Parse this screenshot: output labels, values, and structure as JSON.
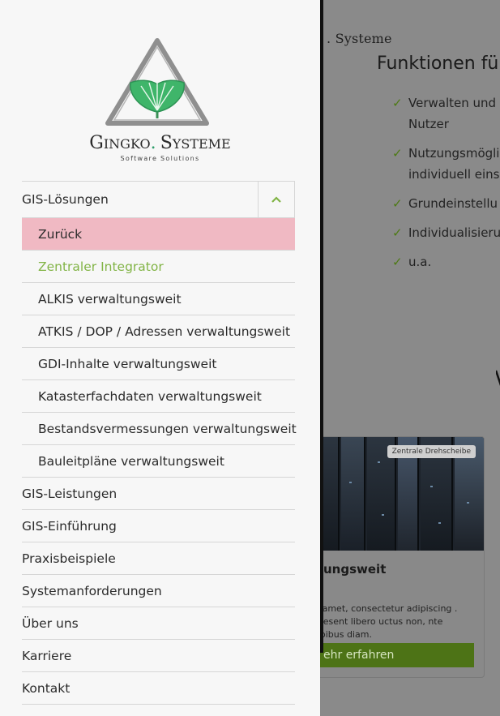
{
  "background_page": {
    "logo_text": ". Systeme",
    "heading": "Funktionen fü",
    "features": [
      {
        "text": "Verwalten und"
      },
      {
        "text": "Nutzer"
      },
      {
        "text": "Nutzungsmögli"
      },
      {
        "text": "individuell eins"
      },
      {
        "text": "Grundeinstellu"
      },
      {
        "text": "Individualisieru"
      },
      {
        "text": "u.a."
      }
    ],
    "check_symbol": "✓",
    "card": {
      "tag": "Zentrale Drehscheibe",
      "title": "ungsweit",
      "description": "sit amet, consectetur adipiscing . Praesent libero uctus non, nte dapibus diam.",
      "button_label": "ehr erfahren"
    }
  },
  "logo": {
    "wordmark_left_G": "G",
    "wordmark_left_rest": "INGKO",
    "wordmark_dot": ".",
    "wordmark_right_S": "S",
    "wordmark_right_rest": "YSTEME",
    "tagline": "Software Solutions",
    "colors": {
      "leaf": "#3fb56a",
      "frame": "#8a8a8a"
    }
  },
  "menu": {
    "top_item": "GIS-Lösungen",
    "toggle_icon": "chevron-up-icon",
    "submenu": [
      {
        "label": "Zurück",
        "state": "back"
      },
      {
        "label": "Zentraler Integrator",
        "state": "active"
      },
      {
        "label": "ALKIS verwaltungsweit",
        "state": ""
      },
      {
        "label": "ATKIS / DOP / Adressen verwaltungsweit",
        "state": ""
      },
      {
        "label": "GDI-Inhalte verwaltungsweit",
        "state": ""
      },
      {
        "label": "Katasterfachdaten verwaltungsweit",
        "state": ""
      },
      {
        "label": "Bestandsvermessungen verwaltungsweit",
        "state": ""
      },
      {
        "label": "Bauleitpläne verwaltungsweit",
        "state": ""
      }
    ],
    "items": [
      {
        "label": "GIS-Leistungen"
      },
      {
        "label": "GIS-Einführung"
      },
      {
        "label": "Praxisbeispiele"
      },
      {
        "label": "Systemanforderungen"
      },
      {
        "label": "Über uns"
      },
      {
        "label": "Karriere"
      },
      {
        "label": "Kontakt"
      }
    ],
    "colors": {
      "back_bg": "#f0b9c3",
      "active_text": "#82b446",
      "chevron": "#82b446"
    }
  }
}
